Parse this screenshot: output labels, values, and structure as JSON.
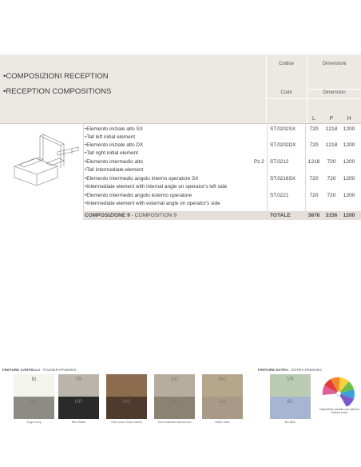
{
  "header": {
    "title_it": "•COMPOSIZIONI RECEPTION",
    "title_en": "•RECEPTION COMPOSITIONS",
    "col_code_it": "Codice",
    "col_code_en": "Code",
    "col_dim_it": "Dimensioni",
    "col_dim_en": "Dimension",
    "col_l": "L",
    "col_p": "P",
    "col_h": "H"
  },
  "pieces_label": "Pz.2",
  "rows": [
    {
      "it": "•Elemento iniziale alto SX",
      "en": "•Tall left initial element",
      "code": "ST.0202SX",
      "l": "720",
      "p": "1218",
      "h": "1200"
    },
    {
      "it": "•Elemento iniziale alto DX",
      "en": "•Tall right initial element",
      "code": "ST.0202DX",
      "l": "720",
      "p": "1218",
      "h": "1200"
    },
    {
      "it": "•Elemento intermedio alto",
      "en": "•Tall intermediate element",
      "code": "ST.0212",
      "l": "1218",
      "p": "720",
      "h": "1200"
    },
    {
      "it": "•Elemento intermedio angolo interno operatore SX",
      "en": "•Intermediate element with internal angle on operator's left side",
      "code": "ST.0216SX",
      "l": "720",
      "p": "720",
      "h": "1200"
    },
    {
      "it": "•Elemento intermedio angolo esterno operatore",
      "en": "•Intermediate element with external angle on operator's side",
      "code": "ST.0221",
      "l": "720",
      "p": "720",
      "h": "1200"
    }
  ],
  "total": {
    "label_it": "COMPOSIZIONE 9",
    "label_sep": " - ",
    "label_en": "COMPOSITION 9",
    "totale": "TOTALE",
    "l": "3876",
    "p": "3156",
    "h": "1200"
  },
  "finishes_folder": {
    "title_bold": "FINITURE CARTELLA",
    "title_rest": " - FOLDER FINISHES",
    "swatches": [
      {
        "code": "BI",
        "name": "Bianco White",
        "color": "#f3f4ec"
      },
      {
        "code": "TR",
        "name": "Tortora Taupe",
        "color": "#bab4aa"
      },
      {
        "code": "NC",
        "name": "Noce chiaro Light walnut",
        "color": "#8c6c4f"
      },
      {
        "code": "OC",
        "name": "Olmo chiaro Light elm",
        "color": "#b7ad9e"
      },
      {
        "code": "RC",
        "name": "Rovere chiaro Light durmast",
        "color": "#b5a68c"
      },
      {
        "code": "GR",
        "name": "Grigio Grey",
        "color": "#8d8b86"
      },
      {
        "code": "NR",
        "name": "Nero Black",
        "color": "#2a2a2a"
      },
      {
        "code": "NS",
        "name": "Noce scuro Dark walnut",
        "color": "#4f3b2c"
      },
      {
        "code": "ON",
        "name": "Olmo naturale Natural elm",
        "color": "#8b8272"
      },
      {
        "code": "SA",
        "name": "Salice Salix",
        "color": "#a89a86"
      }
    ]
  },
  "finishes_extra": {
    "title_bold": "FINITURE EXTRA",
    "title_rest": " - EXTRA FINISHES",
    "swatches": [
      {
        "code": "VR",
        "name": "Verde Green",
        "color": "#b9ccb1"
      },
      {
        "code": "BL",
        "name": "Blu Blue",
        "color": "#a6b6d2"
      }
    ],
    "fan_note": "Disponibile cartella con ulteriori finiture extra"
  }
}
